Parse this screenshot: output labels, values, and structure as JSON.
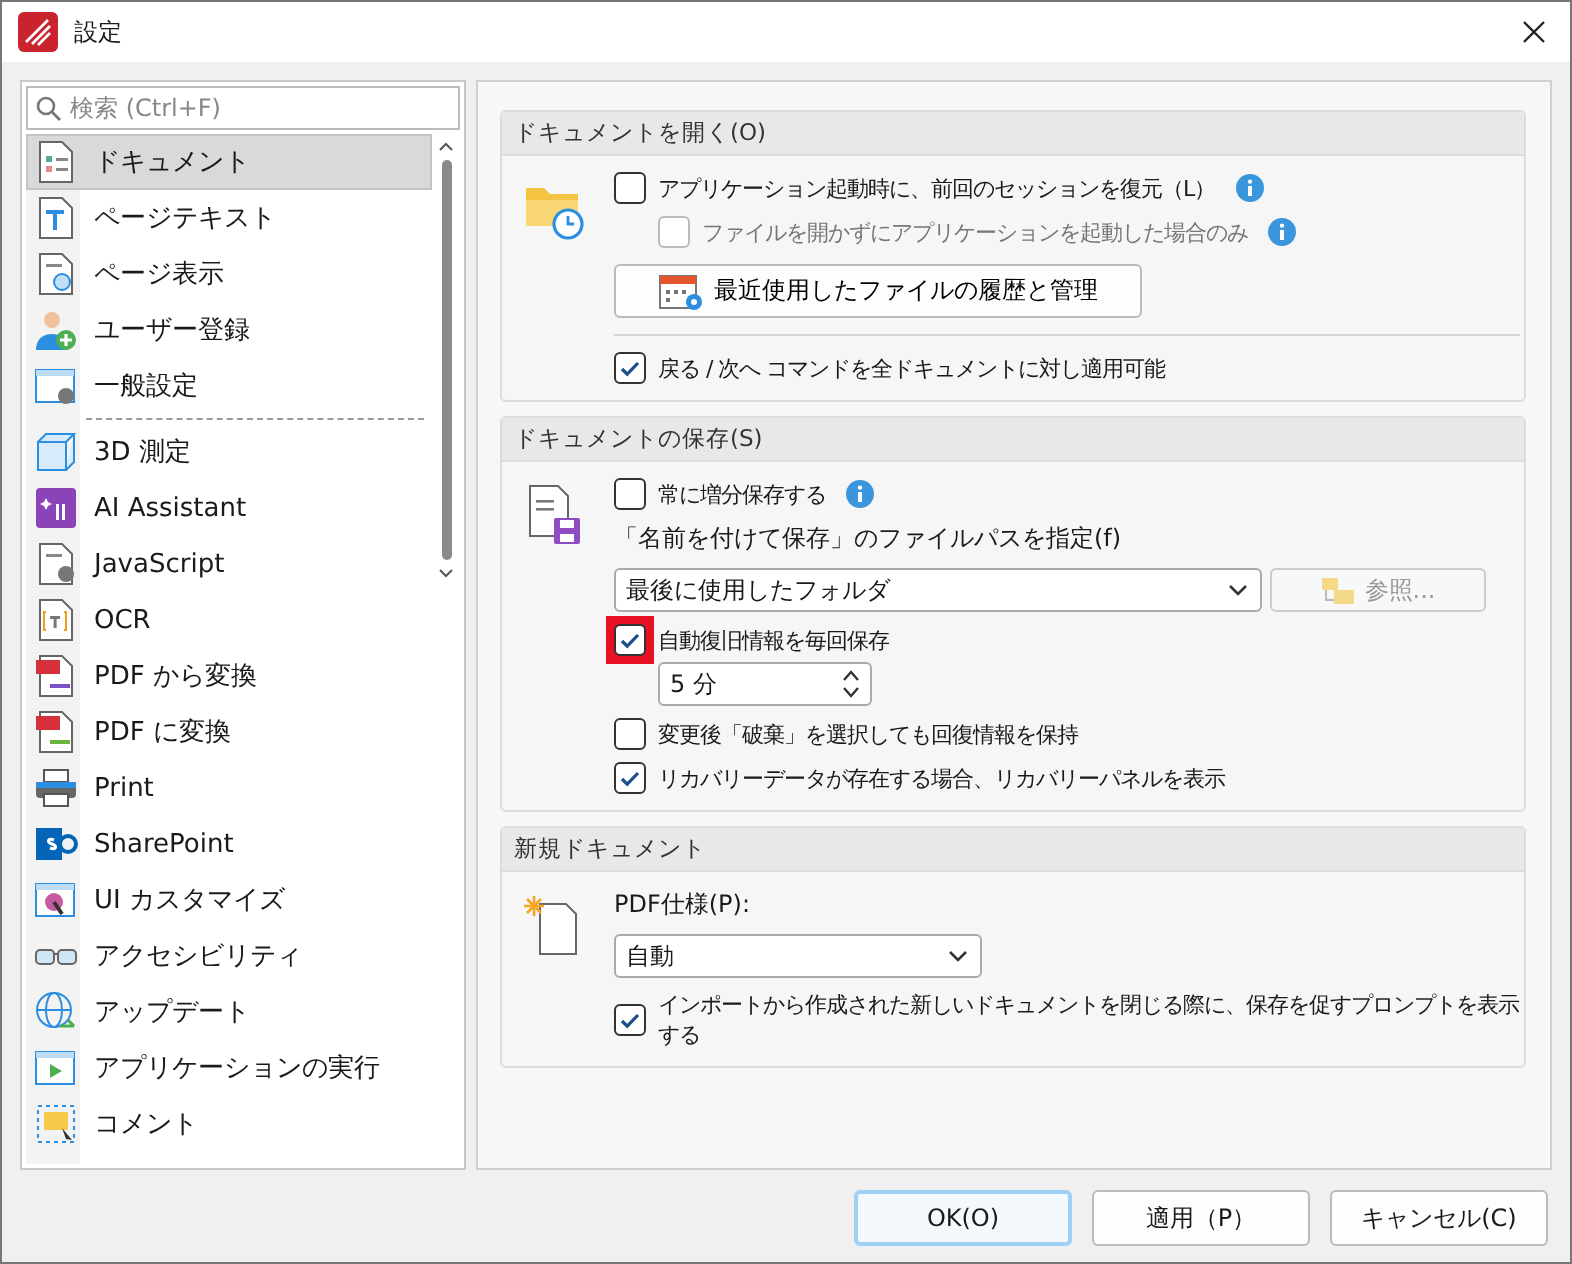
{
  "window": {
    "title": "設定"
  },
  "sidebar": {
    "search": {
      "placeholder": "検索 (Ctrl+F)"
    },
    "items": [
      {
        "label": "ドキュメント",
        "selected": true
      },
      {
        "label": "ページテキスト",
        "selected": false
      },
      {
        "label": "ページ表示",
        "selected": false
      },
      {
        "label": "ユーザー登録",
        "selected": false
      },
      {
        "label": "一般設定",
        "selected": false,
        "separator_after": true
      },
      {
        "label": "3D 測定",
        "selected": false
      },
      {
        "label": "AI Assistant",
        "selected": false
      },
      {
        "label": "JavaScript",
        "selected": false
      },
      {
        "label": "OCR",
        "selected": false
      },
      {
        "label": "PDF から変換",
        "selected": false
      },
      {
        "label": "PDF に変換",
        "selected": false
      },
      {
        "label": "Print",
        "selected": false
      },
      {
        "label": "SharePoint",
        "selected": false
      },
      {
        "label": "UI カスタマイズ",
        "selected": false
      },
      {
        "label": "アクセシビリティ",
        "selected": false
      },
      {
        "label": "アップデート",
        "selected": false
      },
      {
        "label": "アプリケーションの実行",
        "selected": false
      },
      {
        "label": "コメント",
        "selected": false
      }
    ]
  },
  "sections": [
    {
      "title": "ドキュメントを開く(O)",
      "controls": [
        {
          "kind": "checkbox",
          "label": "アプリケーション起動時に、前回のセッションを復元（L）",
          "checked": false,
          "disabled": false,
          "info": true,
          "children": [
            {
              "kind": "checkbox",
              "label": "ファイルを開かずにアプリケーションを起動した場合のみ",
              "checked": false,
              "disabled": true,
              "info": true
            }
          ]
        },
        {
          "kind": "button",
          "label": "最近使用したファイルの履歴と管理"
        },
        {
          "kind": "divider"
        },
        {
          "kind": "checkbox",
          "label": "戻る / 次へ コマンドを全ドキュメントに対し適用可能",
          "checked": true,
          "disabled": false
        }
      ]
    },
    {
      "title": "ドキュメントの保存(S)",
      "controls": [
        {
          "kind": "checkbox",
          "label": "常に増分保存する",
          "checked": false,
          "disabled": false,
          "info": true
        },
        {
          "kind": "label",
          "label": "「名前を付けて保存」のファイルパスを指定(f)"
        },
        {
          "kind": "select",
          "value": "最後に使用したフォルダ",
          "browse": {
            "label": "参照...",
            "disabled": true
          }
        },
        {
          "kind": "checkbox",
          "label": "自動復旧情報を毎回保存",
          "checked": true,
          "disabled": false,
          "highlighted": true,
          "children": [
            {
              "kind": "spinner",
              "value": "5 分"
            }
          ]
        },
        {
          "kind": "checkbox",
          "label": "変更後「破棄」を選択しても回復情報を保持",
          "checked": false,
          "disabled": false
        },
        {
          "kind": "checkbox",
          "label": "リカバリーデータが存在する場合、リカバリーパネルを表示",
          "checked": true,
          "disabled": false
        }
      ]
    },
    {
      "title": "新規ドキュメント",
      "controls": [
        {
          "kind": "label",
          "label": "PDF仕様(P):"
        },
        {
          "kind": "select",
          "value": "自動"
        },
        {
          "kind": "checkbox",
          "label": "インポートから作成された新しいドキュメントを閉じる際に、保存を促すプロンプトを表示する",
          "checked": true,
          "disabled": false
        }
      ]
    }
  ],
  "buttons": [
    {
      "label": "OK(O)",
      "default": true
    },
    {
      "label": "適用（P）",
      "default": false
    },
    {
      "label": "キャンセル(C)",
      "default": false
    }
  ]
}
